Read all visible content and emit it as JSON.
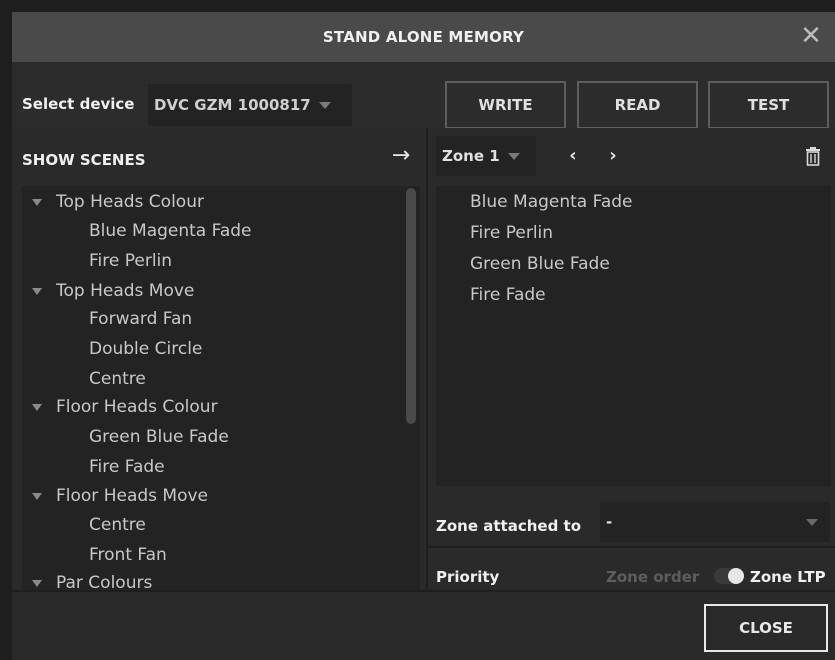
{
  "window": {
    "title": "STAND ALONE MEMORY",
    "close_glyph": "✕"
  },
  "toolbar": {
    "select_device_label": "Select device",
    "device_value": "DVC GZM 1000817",
    "write_label": "WRITE",
    "read_label": "READ",
    "test_label": "TEST"
  },
  "show_scenes": {
    "header": "SHOW SCENES",
    "arrow_glyph": "→",
    "tree": [
      {
        "label": "Top Heads Colour",
        "type": "category"
      },
      {
        "label": "Blue Magenta Fade",
        "type": "scene"
      },
      {
        "label": "Fire Perlin",
        "type": "scene"
      },
      {
        "label": "Top Heads Move",
        "type": "category"
      },
      {
        "label": "Forward Fan",
        "type": "scene"
      },
      {
        "label": "Double Circle",
        "type": "scene"
      },
      {
        "label": "Centre",
        "type": "scene"
      },
      {
        "label": "Floor Heads Colour",
        "type": "category"
      },
      {
        "label": "Green Blue Fade",
        "type": "scene"
      },
      {
        "label": "Fire Fade",
        "type": "scene"
      },
      {
        "label": "Floor Heads Move",
        "type": "category"
      },
      {
        "label": "Centre",
        "type": "scene"
      },
      {
        "label": "Front Fan",
        "type": "scene"
      },
      {
        "label": "Par Colours",
        "type": "category"
      }
    ]
  },
  "zone": {
    "selected": "Zone 1",
    "prev_glyph": "‹",
    "next_glyph": "›",
    "items": [
      "Blue Magenta Fade",
      "Fire Perlin",
      "Green Blue Fade",
      "Fire Fade"
    ],
    "attached_label": "Zone attached to",
    "attached_value": "-",
    "priority_label": "Priority",
    "zone_order_label": "Zone order",
    "zone_ltp_label": "Zone LTP"
  },
  "footer": {
    "close_label": "CLOSE"
  }
}
